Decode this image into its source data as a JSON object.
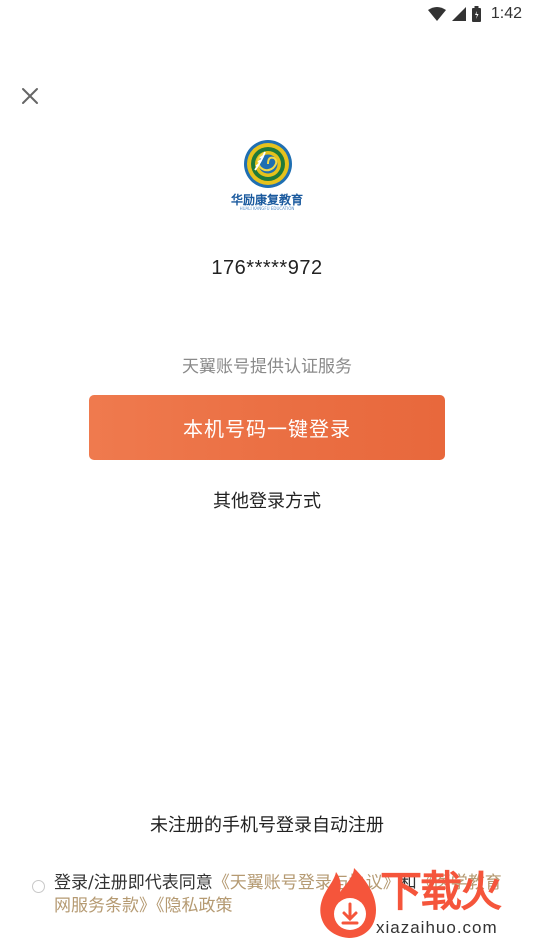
{
  "status_bar": {
    "time": "1:42"
  },
  "logo": {
    "name": "华励康复教育",
    "subtitle": "HUALI KANGFU EDUCATION"
  },
  "phone_masked": "176*****972",
  "provider_note": "天翼账号提供认证服务",
  "login_button_label": "本机号码一键登录",
  "other_login_label": "其他登录方式",
  "auto_register_note": "未注册的手机号登录自动注册",
  "agreement": {
    "prefix": "登录/注册即代表同意",
    "link1": "《天翼账号登录与协议》",
    "conj": "和",
    "link2": "《医学教育网服务条款》",
    "link3": "《隐私政策",
    "link_color": "#b59a72"
  },
  "watermark": {
    "title": "下载火",
    "url": "xiazaihuo.com"
  },
  "colors": {
    "accent": "#ea6e42",
    "muted_text": "#8a8a8a"
  }
}
